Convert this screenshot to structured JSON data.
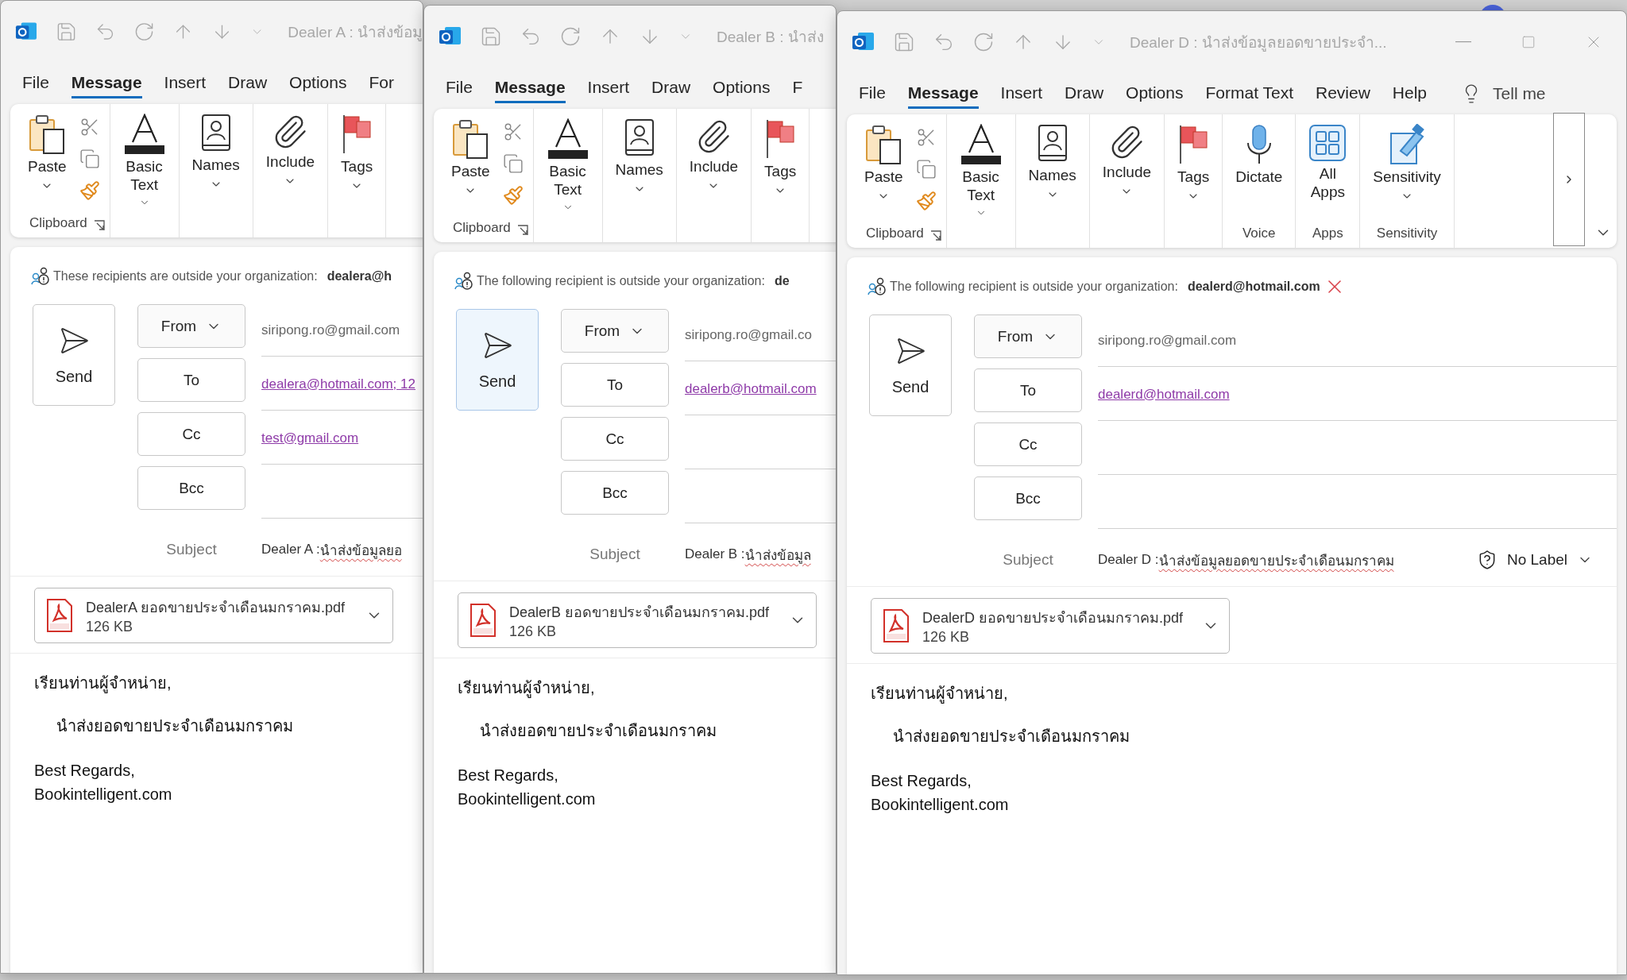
{
  "windows": [
    {
      "title": "Dealer A : นำส่งข้อมู",
      "window_controls": false,
      "tabs": [
        {
          "label": "File",
          "selected": false
        },
        {
          "label": "Message",
          "selected": true
        },
        {
          "label": "Insert",
          "selected": false
        },
        {
          "label": "Draw",
          "selected": false
        },
        {
          "label": "Options",
          "selected": false
        },
        {
          "label": "For",
          "selected": false
        }
      ],
      "ribbon": {
        "overflow": false,
        "groups": [
          {
            "label": "Clipboard",
            "launcher": true,
            "buttons": [
              {
                "kind": "paste",
                "label": "Paste",
                "dropdown": true
              },
              {
                "kind": "cut"
              },
              {
                "kind": "copy"
              },
              {
                "kind": "painter"
              }
            ]
          },
          {
            "buttons": [
              {
                "kind": "basic_text",
                "label": "Basic Text",
                "dropdown": true
              }
            ]
          },
          {
            "buttons": [
              {
                "kind": "names",
                "label": "Names",
                "dropdown": true
              }
            ]
          },
          {
            "buttons": [
              {
                "kind": "include",
                "label": "Include",
                "dropdown": true
              }
            ]
          },
          {
            "buttons": [
              {
                "kind": "tags",
                "label": "Tags",
                "dropdown": true
              }
            ]
          }
        ]
      },
      "notice": {
        "text": "These recipients are outside your organization:",
        "recipient": "dealera@h",
        "dismiss": false
      },
      "send": {
        "label": "Send",
        "hovered": false
      },
      "fields": [
        {
          "label": "From",
          "kind": "sender",
          "value": "siripong.ro@gmail.com"
        },
        {
          "label": "To",
          "kind": "recipient",
          "value": "dealera@hotmail.com; 12"
        },
        {
          "label": "Cc",
          "kind": "recipient",
          "value": "test@gmail.com"
        },
        {
          "label": "Bcc",
          "kind": "recipient"
        }
      ],
      "subject": {
        "label": "Subject",
        "prefix": "Dealer A : ",
        "text": "นำส่งข้อมูลยอ"
      },
      "attachment": {
        "name": "DealerA ยอดขายประจำเดือนมกราคม.pdf",
        "size": "126 KB"
      },
      "body": {
        "greeting": "เรียนท่านผู้จำหน่าย,",
        "message": "นำส่งยอดขายประจำเดือนมกราคม",
        "closing": "Best Regards,",
        "signature": "Bookintelligent.com"
      }
    },
    {
      "title": "Dealer B : นำส่ง",
      "window_controls": false,
      "tabs": [
        {
          "label": "File",
          "selected": false
        },
        {
          "label": "Message",
          "selected": true
        },
        {
          "label": "Insert",
          "selected": false
        },
        {
          "label": "Draw",
          "selected": false
        },
        {
          "label": "Options",
          "selected": false
        },
        {
          "label": "F",
          "selected": false
        }
      ],
      "ribbon": {
        "overflow": false,
        "groups": [
          {
            "label": "Clipboard",
            "launcher": true,
            "buttons": [
              {
                "kind": "paste",
                "label": "Paste",
                "dropdown": true
              },
              {
                "kind": "cut"
              },
              {
                "kind": "copy"
              },
              {
                "kind": "painter"
              }
            ]
          },
          {
            "buttons": [
              {
                "kind": "basic_text",
                "label": "Basic Text",
                "dropdown": true
              }
            ]
          },
          {
            "buttons": [
              {
                "kind": "names",
                "label": "Names",
                "dropdown": true
              }
            ]
          },
          {
            "buttons": [
              {
                "kind": "include",
                "label": "Include",
                "dropdown": true
              }
            ]
          },
          {
            "buttons": [
              {
                "kind": "tags",
                "label": "Tags",
                "dropdown": true
              }
            ]
          }
        ]
      },
      "notice": {
        "text": "The following recipient is outside your organization:",
        "recipient": "de",
        "dismiss": false
      },
      "send": {
        "label": "Send",
        "hovered": true
      },
      "fields": [
        {
          "label": "From",
          "kind": "sender",
          "value": "siripong.ro@gmail.co"
        },
        {
          "label": "To",
          "kind": "recipient",
          "value": "dealerb@hotmail.com"
        },
        {
          "label": "Cc",
          "kind": "recipient"
        },
        {
          "label": "Bcc",
          "kind": "recipient"
        }
      ],
      "subject": {
        "label": "Subject",
        "prefix": "Dealer B : ",
        "text": "นำส่งข้อมูล"
      },
      "attachment": {
        "name": "DealerB ยอดขายประจำเดือนมกราคม.pdf",
        "size": "126 KB"
      },
      "body": {
        "greeting": "เรียนท่านผู้จำหน่าย,",
        "message": "นำส่งยอดขายประจำเดือนมกราคม",
        "closing": "Best Regards,",
        "signature": "Bookintelligent.com"
      }
    },
    {
      "title": "Dealer D : นำส่งข้อมูลยอดขายประจำ...",
      "window_controls": true,
      "tabs": [
        {
          "label": "File",
          "selected": false
        },
        {
          "label": "Message",
          "selected": true
        },
        {
          "label": "Insert",
          "selected": false
        },
        {
          "label": "Draw",
          "selected": false
        },
        {
          "label": "Options",
          "selected": false
        },
        {
          "label": "Format Text",
          "selected": false
        },
        {
          "label": "Review",
          "selected": false
        },
        {
          "label": "Help",
          "selected": false
        }
      ],
      "tell_me": "Tell me",
      "ribbon": {
        "overflow": true,
        "groups": [
          {
            "label": "Clipboard",
            "launcher": true,
            "buttons": [
              {
                "kind": "paste",
                "label": "Paste",
                "dropdown": true
              },
              {
                "kind": "cut"
              },
              {
                "kind": "copy"
              },
              {
                "kind": "painter"
              }
            ]
          },
          {
            "buttons": [
              {
                "kind": "basic_text",
                "label": "Basic Text",
                "dropdown": true
              }
            ]
          },
          {
            "buttons": [
              {
                "kind": "names",
                "label": "Names",
                "dropdown": true
              }
            ]
          },
          {
            "buttons": [
              {
                "kind": "include",
                "label": "Include",
                "dropdown": true
              }
            ]
          },
          {
            "buttons": [
              {
                "kind": "tags",
                "label": "Tags",
                "dropdown": true
              }
            ]
          },
          {
            "label": "Voice",
            "buttons": [
              {
                "kind": "dictate",
                "label": "Dictate",
                "dropdown": false
              }
            ]
          },
          {
            "label": "Apps",
            "buttons": [
              {
                "kind": "apps",
                "label": "All Apps",
                "dropdown": false
              }
            ]
          },
          {
            "label": "Sensitivity",
            "buttons": [
              {
                "kind": "sensitivity",
                "label": "Sensitivity",
                "dropdown": true
              }
            ]
          }
        ]
      },
      "notice": {
        "text": "The following recipient is outside your organization:",
        "recipient": "dealerd@hotmail.com",
        "dismiss": true
      },
      "send": {
        "label": "Send",
        "hovered": false
      },
      "fields": [
        {
          "label": "From",
          "kind": "sender",
          "value": "siripong.ro@gmail.com"
        },
        {
          "label": "To",
          "kind": "recipient",
          "value": "dealerd@hotmail.com"
        },
        {
          "label": "Cc",
          "kind": "recipient"
        },
        {
          "label": "Bcc",
          "kind": "recipient"
        }
      ],
      "subject": {
        "label": "Subject",
        "prefix": "Dealer D : ",
        "text": "นำส่งข้อมูลยอดขายประจำเดือนมกราคม",
        "sensitivity": "No Label"
      },
      "attachment": {
        "name": "DealerD ยอดขายประจำเดือนมกราคม.pdf",
        "size": "126 KB"
      },
      "body": {
        "greeting": "เรียนท่านผู้จำหน่าย,",
        "message": "นำส่งยอดขายประจำเดือนมกราคม",
        "closing": "Best Regards,",
        "signature": "Bookintelligent.com"
      }
    }
  ]
}
